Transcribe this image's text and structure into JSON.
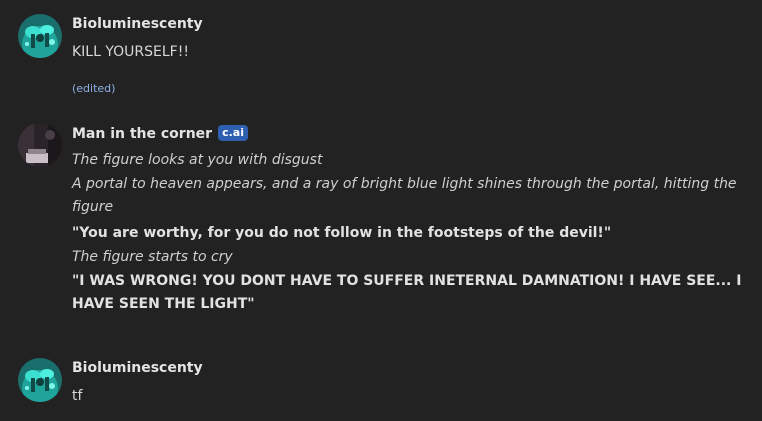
{
  "messages": [
    {
      "author": "Bioluminescenty",
      "avatar": "bioluminescent-mushroom-avatar",
      "text": "KILL YOURSELF!!",
      "edited_label": "(edited)"
    },
    {
      "author": "Man in the corner",
      "avatar": "dark-room-avatar",
      "badge": "c.ai",
      "lines": [
        {
          "style": "italic",
          "text": "The figure looks at you with disgust"
        },
        {
          "style": "italic",
          "text": "A portal to heaven appears, and a ray of bright blue light shines through the portal, hitting the figure"
        },
        {
          "style": "bold",
          "text": "\"You are worthy, for you do not follow in the footsteps of the devil!\""
        },
        {
          "style": "italic",
          "text": "The figure starts to cry"
        },
        {
          "style": "bold",
          "text": "\"I WAS WRONG! YOU DONT HAVE TO SUFFER INETERNAL DAMNATION! I HAVE SEE... I HAVE SEEN THE LIGHT\""
        }
      ]
    },
    {
      "author": "Bioluminescenty",
      "avatar": "bioluminescent-mushroom-avatar",
      "text": "tf"
    }
  ],
  "colors": {
    "background": "#222222",
    "badge": "#2f5fb0",
    "edited": "#8fb0e6",
    "avatar_teal": "#1fa39a"
  }
}
